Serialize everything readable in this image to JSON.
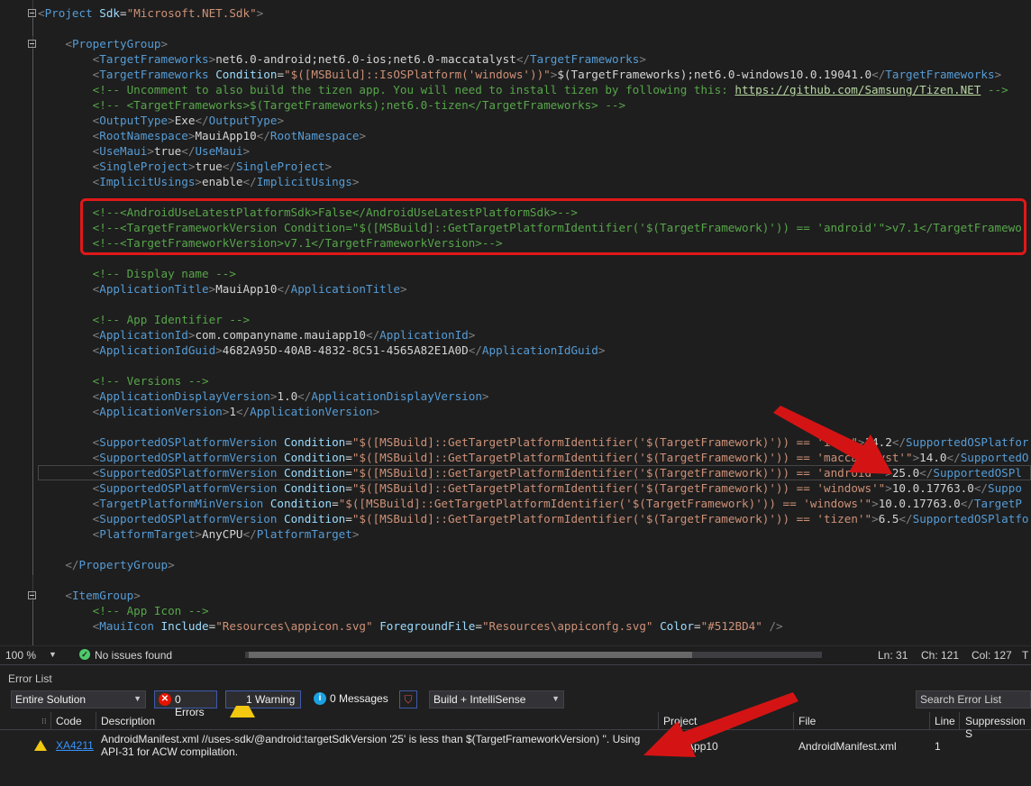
{
  "editor": {
    "lines": [
      {
        "segs": [
          [
            "p",
            "<"
          ],
          [
            "t",
            "Project"
          ],
          [
            "tx",
            " "
          ],
          [
            "a",
            "Sdk"
          ],
          [
            "tx",
            "="
          ],
          [
            "v",
            "\"Microsoft.NET.Sdk\""
          ],
          [
            "p",
            ">"
          ]
        ]
      },
      {
        "segs": []
      },
      {
        "segs": [
          [
            "tx",
            "    "
          ],
          [
            "p",
            "<"
          ],
          [
            "t",
            "PropertyGroup"
          ],
          [
            "p",
            ">"
          ]
        ]
      },
      {
        "segs": [
          [
            "tx",
            "        "
          ],
          [
            "p",
            "<"
          ],
          [
            "t",
            "TargetFrameworks"
          ],
          [
            "p",
            ">"
          ],
          [
            "tx",
            "net6.0-android;net6.0-ios;net6.0-maccatalyst"
          ],
          [
            "p",
            "</"
          ],
          [
            "t",
            "TargetFrameworks"
          ],
          [
            "p",
            ">"
          ]
        ]
      },
      {
        "segs": [
          [
            "tx",
            "        "
          ],
          [
            "p",
            "<"
          ],
          [
            "t",
            "TargetFrameworks"
          ],
          [
            "tx",
            " "
          ],
          [
            "a",
            "Condition"
          ],
          [
            "tx",
            "="
          ],
          [
            "v",
            "\"$([MSBuild]::IsOSPlatform('windows'))\""
          ],
          [
            "p",
            ">"
          ],
          [
            "tx",
            "$(TargetFrameworks);net6.0-windows10.0.19041.0"
          ],
          [
            "p",
            "</"
          ],
          [
            "t",
            "TargetFrameworks"
          ],
          [
            "p",
            ">"
          ]
        ]
      },
      {
        "segs": [
          [
            "tx",
            "        "
          ],
          [
            "c",
            "<!-- Uncomment to also build the tizen app. You will need to install tizen by following this: "
          ],
          [
            "lnk",
            "https://github.com/Samsung/Tizen.NET"
          ],
          [
            "c",
            " -->"
          ]
        ]
      },
      {
        "segs": [
          [
            "tx",
            "        "
          ],
          [
            "c",
            "<!-- <TargetFrameworks>$(TargetFrameworks);net6.0-tizen</TargetFrameworks> -->"
          ]
        ]
      },
      {
        "segs": [
          [
            "tx",
            "        "
          ],
          [
            "p",
            "<"
          ],
          [
            "t",
            "OutputType"
          ],
          [
            "p",
            ">"
          ],
          [
            "tx",
            "Exe"
          ],
          [
            "p",
            "</"
          ],
          [
            "t",
            "OutputType"
          ],
          [
            "p",
            ">"
          ]
        ]
      },
      {
        "segs": [
          [
            "tx",
            "        "
          ],
          [
            "p",
            "<"
          ],
          [
            "t",
            "RootNamespace"
          ],
          [
            "p",
            ">"
          ],
          [
            "tx",
            "MauiApp10"
          ],
          [
            "p",
            "</"
          ],
          [
            "t",
            "RootNamespace"
          ],
          [
            "p",
            ">"
          ]
        ]
      },
      {
        "segs": [
          [
            "tx",
            "        "
          ],
          [
            "p",
            "<"
          ],
          [
            "t",
            "UseMaui"
          ],
          [
            "p",
            ">"
          ],
          [
            "tx",
            "true"
          ],
          [
            "p",
            "</"
          ],
          [
            "t",
            "UseMaui"
          ],
          [
            "p",
            ">"
          ]
        ]
      },
      {
        "segs": [
          [
            "tx",
            "        "
          ],
          [
            "p",
            "<"
          ],
          [
            "t",
            "SingleProject"
          ],
          [
            "p",
            ">"
          ],
          [
            "tx",
            "true"
          ],
          [
            "p",
            "</"
          ],
          [
            "t",
            "SingleProject"
          ],
          [
            "p",
            ">"
          ]
        ]
      },
      {
        "segs": [
          [
            "tx",
            "        "
          ],
          [
            "p",
            "<"
          ],
          [
            "t",
            "ImplicitUsings"
          ],
          [
            "p",
            ">"
          ],
          [
            "tx",
            "enable"
          ],
          [
            "p",
            "</"
          ],
          [
            "t",
            "ImplicitUsings"
          ],
          [
            "p",
            ">"
          ]
        ]
      },
      {
        "segs": []
      },
      {
        "segs": [
          [
            "tx",
            "        "
          ],
          [
            "c",
            "<!--<AndroidUseLatestPlatformSdk>False</AndroidUseLatestPlatformSdk>-->"
          ]
        ]
      },
      {
        "segs": [
          [
            "tx",
            "        "
          ],
          [
            "c",
            "<!--<TargetFrameworkVersion Condition=\"$([MSBuild]::GetTargetPlatformIdentifier('$(TargetFramework)')) == 'android'\">v7.1</TargetFramewo"
          ]
        ]
      },
      {
        "segs": [
          [
            "tx",
            "        "
          ],
          [
            "c",
            "<!--<TargetFrameworkVersion>v7.1</TargetFrameworkVersion>-->"
          ]
        ]
      },
      {
        "segs": []
      },
      {
        "segs": [
          [
            "tx",
            "        "
          ],
          [
            "c",
            "<!-- Display name -->"
          ]
        ]
      },
      {
        "segs": [
          [
            "tx",
            "        "
          ],
          [
            "p",
            "<"
          ],
          [
            "t",
            "ApplicationTitle"
          ],
          [
            "p",
            ">"
          ],
          [
            "tx",
            "MauiApp10"
          ],
          [
            "p",
            "</"
          ],
          [
            "t",
            "ApplicationTitle"
          ],
          [
            "p",
            ">"
          ]
        ]
      },
      {
        "segs": []
      },
      {
        "segs": [
          [
            "tx",
            "        "
          ],
          [
            "c",
            "<!-- App Identifier -->"
          ]
        ]
      },
      {
        "segs": [
          [
            "tx",
            "        "
          ],
          [
            "p",
            "<"
          ],
          [
            "t",
            "ApplicationId"
          ],
          [
            "p",
            ">"
          ],
          [
            "tx",
            "com.companyname.mauiapp10"
          ],
          [
            "p",
            "</"
          ],
          [
            "t",
            "ApplicationId"
          ],
          [
            "p",
            ">"
          ]
        ]
      },
      {
        "segs": [
          [
            "tx",
            "        "
          ],
          [
            "p",
            "<"
          ],
          [
            "t",
            "ApplicationIdGuid"
          ],
          [
            "p",
            ">"
          ],
          [
            "tx",
            "4682A95D-40AB-4832-8C51-4565A82E1A0D"
          ],
          [
            "p",
            "</"
          ],
          [
            "t",
            "ApplicationIdGuid"
          ],
          [
            "p",
            ">"
          ]
        ]
      },
      {
        "segs": []
      },
      {
        "segs": [
          [
            "tx",
            "        "
          ],
          [
            "c",
            "<!-- Versions -->"
          ]
        ]
      },
      {
        "segs": [
          [
            "tx",
            "        "
          ],
          [
            "p",
            "<"
          ],
          [
            "t",
            "ApplicationDisplayVersion"
          ],
          [
            "p",
            ">"
          ],
          [
            "tx",
            "1.0"
          ],
          [
            "p",
            "</"
          ],
          [
            "t",
            "ApplicationDisplayVersion"
          ],
          [
            "p",
            ">"
          ]
        ]
      },
      {
        "segs": [
          [
            "tx",
            "        "
          ],
          [
            "p",
            "<"
          ],
          [
            "t",
            "ApplicationVersion"
          ],
          [
            "p",
            ">"
          ],
          [
            "tx",
            "1"
          ],
          [
            "p",
            "</"
          ],
          [
            "t",
            "ApplicationVersion"
          ],
          [
            "p",
            ">"
          ]
        ]
      },
      {
        "segs": []
      },
      {
        "segs": [
          [
            "tx",
            "        "
          ],
          [
            "p",
            "<"
          ],
          [
            "t",
            "SupportedOSPlatformVersion"
          ],
          [
            "tx",
            " "
          ],
          [
            "a",
            "Condition"
          ],
          [
            "tx",
            "="
          ],
          [
            "v",
            "\"$([MSBuild]::GetTargetPlatformIdentifier('$(TargetFramework)')) == 'ios'\""
          ],
          [
            "p",
            ">"
          ],
          [
            "tx",
            "14.2"
          ],
          [
            "p",
            "</"
          ],
          [
            "t",
            "SupportedOSPlatfor"
          ]
        ]
      },
      {
        "segs": [
          [
            "tx",
            "        "
          ],
          [
            "p",
            "<"
          ],
          [
            "t",
            "SupportedOSPlatformVersion"
          ],
          [
            "tx",
            " "
          ],
          [
            "a",
            "Condition"
          ],
          [
            "tx",
            "="
          ],
          [
            "v",
            "\"$([MSBuild]::GetTargetPlatformIdentifier('$(TargetFramework)')) == 'maccatalyst'\""
          ],
          [
            "p",
            ">"
          ],
          [
            "tx",
            "14.0"
          ],
          [
            "p",
            "</"
          ],
          [
            "t",
            "SupportedO"
          ]
        ]
      },
      {
        "current": true,
        "segs": [
          [
            "tx",
            "        "
          ],
          [
            "p",
            "<"
          ],
          [
            "t",
            "SupportedOSPlatformVersion"
          ],
          [
            "tx",
            " "
          ],
          [
            "a",
            "Condition"
          ],
          [
            "tx",
            "="
          ],
          [
            "v",
            "\"$([MSBuild]::GetTargetPlatformIdentifier('$(TargetFramework)')) == 'android'\""
          ],
          [
            "p",
            ">"
          ],
          [
            "tx",
            "25.0"
          ],
          [
            "p",
            "</"
          ],
          [
            "t",
            "SupportedOSPl"
          ]
        ]
      },
      {
        "segs": [
          [
            "tx",
            "        "
          ],
          [
            "p",
            "<"
          ],
          [
            "t",
            "SupportedOSPlatformVersion"
          ],
          [
            "tx",
            " "
          ],
          [
            "a",
            "Condition"
          ],
          [
            "tx",
            "="
          ],
          [
            "v",
            "\"$([MSBuild]::GetTargetPlatformIdentifier('$(TargetFramework)')) == 'windows'\""
          ],
          [
            "p",
            ">"
          ],
          [
            "tx",
            "10.0.17763.0"
          ],
          [
            "p",
            "</"
          ],
          [
            "t",
            "Suppo"
          ]
        ]
      },
      {
        "segs": [
          [
            "tx",
            "        "
          ],
          [
            "p",
            "<"
          ],
          [
            "t",
            "TargetPlatformMinVersion"
          ],
          [
            "tx",
            " "
          ],
          [
            "a",
            "Condition"
          ],
          [
            "tx",
            "="
          ],
          [
            "v",
            "\"$([MSBuild]::GetTargetPlatformIdentifier('$(TargetFramework)')) == 'windows'\""
          ],
          [
            "p",
            ">"
          ],
          [
            "tx",
            "10.0.17763.0"
          ],
          [
            "p",
            "</"
          ],
          [
            "t",
            "TargetP"
          ]
        ]
      },
      {
        "segs": [
          [
            "tx",
            "        "
          ],
          [
            "p",
            "<"
          ],
          [
            "t",
            "SupportedOSPlatformVersion"
          ],
          [
            "tx",
            " "
          ],
          [
            "a",
            "Condition"
          ],
          [
            "tx",
            "="
          ],
          [
            "v",
            "\"$([MSBuild]::GetTargetPlatformIdentifier('$(TargetFramework)')) == 'tizen'\""
          ],
          [
            "p",
            ">"
          ],
          [
            "tx",
            "6.5"
          ],
          [
            "p",
            "</"
          ],
          [
            "t",
            "SupportedOSPlatfo"
          ]
        ]
      },
      {
        "segs": [
          [
            "tx",
            "        "
          ],
          [
            "p",
            "<"
          ],
          [
            "t",
            "PlatformTarget"
          ],
          [
            "p",
            ">"
          ],
          [
            "tx",
            "AnyCPU"
          ],
          [
            "p",
            "</"
          ],
          [
            "t",
            "PlatformTarget"
          ],
          [
            "p",
            ">"
          ]
        ]
      },
      {
        "segs": []
      },
      {
        "segs": [
          [
            "tx",
            "    "
          ],
          [
            "p",
            "</"
          ],
          [
            "t",
            "PropertyGroup"
          ],
          [
            "p",
            ">"
          ]
        ]
      },
      {
        "segs": []
      },
      {
        "segs": [
          [
            "tx",
            "    "
          ],
          [
            "p",
            "<"
          ],
          [
            "t",
            "ItemGroup"
          ],
          [
            "p",
            ">"
          ]
        ]
      },
      {
        "segs": [
          [
            "tx",
            "        "
          ],
          [
            "c",
            "<!-- App Icon -->"
          ]
        ]
      },
      {
        "segs": [
          [
            "tx",
            "        "
          ],
          [
            "p",
            "<"
          ],
          [
            "t",
            "MauiIcon"
          ],
          [
            "tx",
            " "
          ],
          [
            "a",
            "Include"
          ],
          [
            "tx",
            "="
          ],
          [
            "v",
            "\"Resources\\appicon.svg\""
          ],
          [
            "tx",
            " "
          ],
          [
            "a",
            "ForegroundFile"
          ],
          [
            "tx",
            "="
          ],
          [
            "v",
            "\"Resources\\appiconfg.svg\""
          ],
          [
            "tx",
            " "
          ],
          [
            "a",
            "Color"
          ],
          [
            "tx",
            "="
          ],
          [
            "v",
            "\"#512BD4\""
          ],
          [
            "tx",
            " "
          ],
          [
            "p",
            "/>"
          ]
        ]
      }
    ]
  },
  "status": {
    "zoom": "100 %",
    "issues": "No issues found",
    "ln": "Ln: 31",
    "ch": "Ch: 121",
    "col": "Col: 127",
    "tabs": "T"
  },
  "error_list": {
    "title": "Error List",
    "scope": "Entire Solution",
    "errors": "0 Errors",
    "warnings": "1 Warning",
    "messages": "0 Messages",
    "build_filter": "Build + IntelliSense",
    "search_placeholder": "Search Error List",
    "headers": {
      "code": "Code",
      "description": "Description",
      "project": "Project",
      "file": "File",
      "line": "Line",
      "suppression": "Suppression S"
    },
    "rows": [
      {
        "code": "XA4211",
        "description": "AndroidManifest.xml //uses-sdk/@android:targetSdkVersion '25' is less than $(TargetFrameworkVersion) ''. Using API-31 for ACW compilation.",
        "project": "MauiApp10",
        "file": "AndroidManifest.xml",
        "line": "1"
      }
    ]
  },
  "colors": {
    "highlight_box": "#e01818",
    "arrow": "#d41414",
    "accent": "#3f5aa9"
  }
}
